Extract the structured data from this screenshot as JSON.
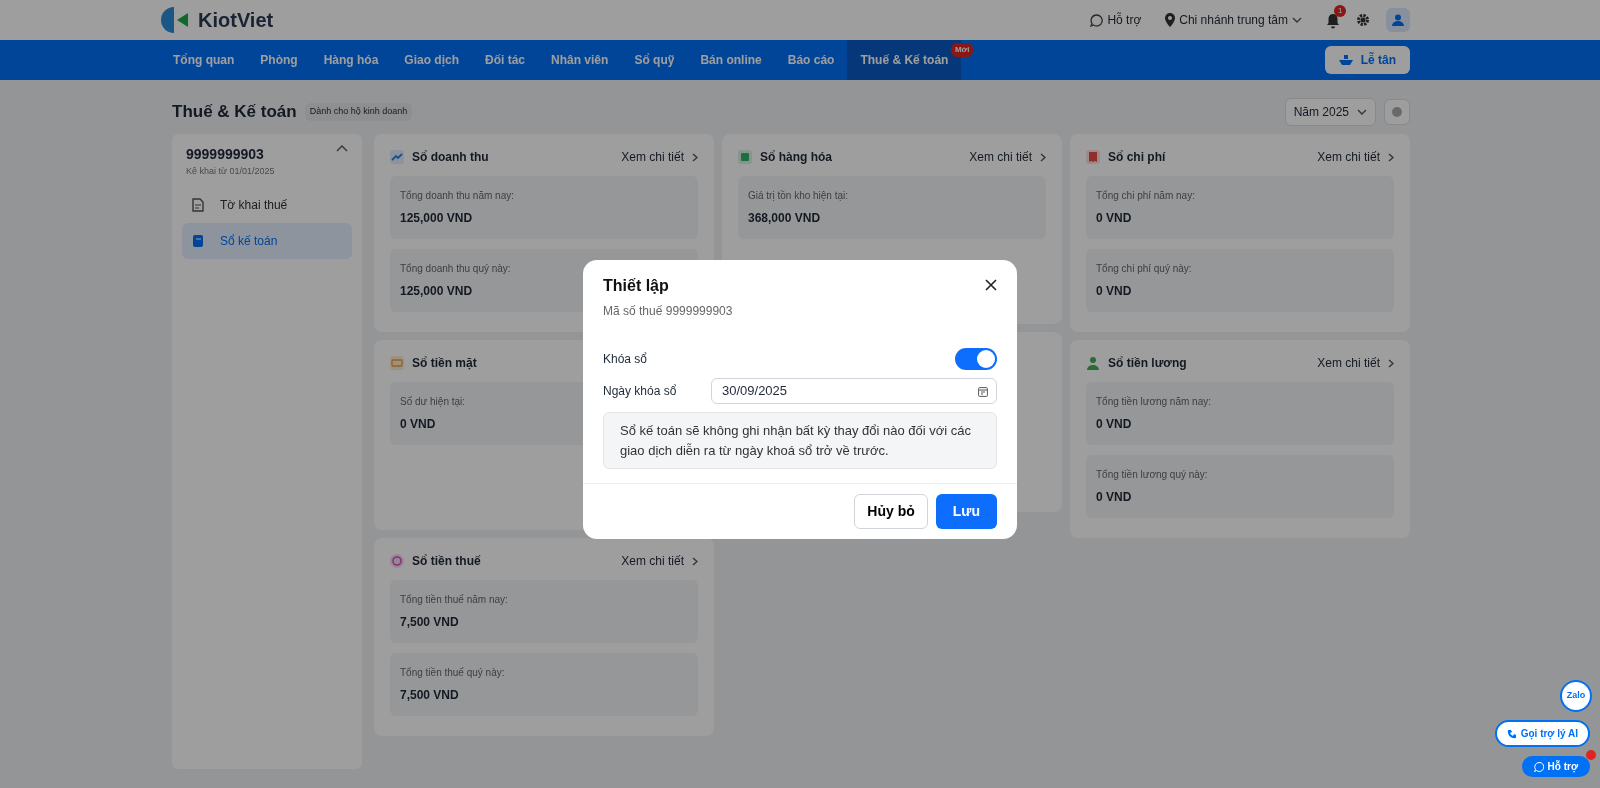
{
  "header": {
    "logo": "KiotViet",
    "support": "Hỗ trợ",
    "branch": "Chi nhánh trung tâm",
    "notification_count": "1"
  },
  "nav": {
    "items": [
      {
        "label": "Tổng quan",
        "selected": false
      },
      {
        "label": "Phòng",
        "selected": false
      },
      {
        "label": "Hàng hóa",
        "selected": false
      },
      {
        "label": "Giao dịch",
        "selected": false
      },
      {
        "label": "Đối tác",
        "selected": false
      },
      {
        "label": "Nhân viên",
        "selected": false
      },
      {
        "label": "Sổ quỹ",
        "selected": false
      },
      {
        "label": "Bán online",
        "selected": false
      },
      {
        "label": "Báo cáo",
        "selected": false
      },
      {
        "label": "Thuế & Kế toán",
        "selected": true,
        "badge": "Mới"
      }
    ],
    "reception_button": "Lễ tân"
  },
  "page": {
    "title": "Thuế & Kế toán",
    "tag": "Dành cho hộ kinh doanh",
    "year_select": "Năm 2025"
  },
  "sidebar": {
    "tax_id": "9999999903",
    "subtitle": "Kê khai từ 01/01/2025",
    "expanded": true,
    "items": [
      {
        "label": "Tờ khai thuế",
        "selected": false
      },
      {
        "label": "Sổ kế toán",
        "selected": true
      }
    ]
  },
  "columns": [
    [
      {
        "title": "Sổ doanh thu",
        "link": "Xem chi tiết",
        "kind": "revenue",
        "metrics": [
          {
            "label": "Tổng doanh thu năm nay:",
            "value": "125,000 VND"
          },
          {
            "label": "Tổng doanh thu quý này:",
            "value": "125,000 VND"
          }
        ]
      },
      {
        "title": "Sổ tiền mặt",
        "kind": "cash",
        "metrics": [
          {
            "label": "Số dư hiện tại:",
            "value": "0 VND"
          }
        ]
      },
      {
        "title": "Sổ tiền thuế",
        "link": "Xem chi tiết",
        "kind": "tax",
        "metrics": [
          {
            "label": "Tổng tiền thuế năm nay:",
            "value": "7,500 VND"
          },
          {
            "label": "Tổng tiền thuế quý này:",
            "value": "7,500 VND"
          }
        ]
      }
    ],
    [
      {
        "title": "Sổ hàng hóa",
        "link": "Xem chi tiết",
        "kind": "goods",
        "metrics": [
          {
            "label": "Giá trị tồn kho hiện tại:",
            "value": "368,000 VND"
          }
        ]
      }
    ],
    [
      {
        "title": "Sổ chi phí",
        "link": "Xem chi tiết",
        "kind": "expense",
        "metrics": [
          {
            "label": "Tổng chi phí năm nay:",
            "value": "0 VND"
          },
          {
            "label": "Tổng chi phí quý này:",
            "value": "0 VND"
          }
        ]
      },
      {
        "title": "Sổ tiền lương",
        "link": "Xem chi tiết",
        "kind": "salary",
        "metrics": [
          {
            "label": "Tổng tiền lương năm nay:",
            "value": "0 VND"
          },
          {
            "label": "Tổng tiền lương quý này:",
            "value": "0 VND"
          }
        ]
      }
    ]
  ],
  "dialog": {
    "title": "Thiết lập",
    "subtitle": "Mã số thuế 9999999903",
    "lock_label": "Khóa sổ",
    "lock_on": true,
    "date_label": "Ngày khóa sổ",
    "date_value": "30/09/2025",
    "note": "Sổ kế toán sẽ không ghi nhận bất kỳ thay đổi nào đối với các giao dịch diễn ra từ ngày khoá sổ trở về trước.",
    "cancel": "Hủy bỏ",
    "save": "Lưu"
  },
  "floating": {
    "zalo": "Zalo",
    "ai_call": "Gọi trợ lý AI",
    "support": "Hỗ trợ"
  }
}
